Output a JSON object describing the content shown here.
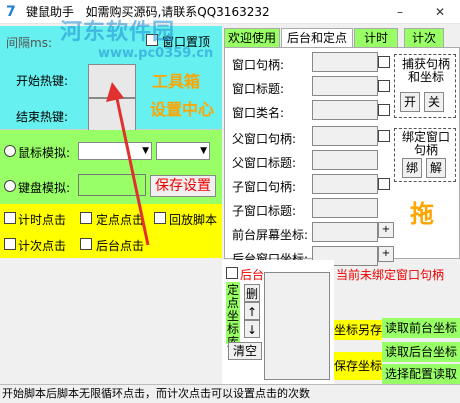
{
  "title": {
    "app_name": "键鼠助手",
    "promo": "如需购买源码,请联系QQ3163232",
    "minimize": "–",
    "close": "✕"
  },
  "watermark": {
    "name": "河东软件园",
    "url": "www.pc0359.cn"
  },
  "hotkeys": {
    "time_label": "间隔ms:",
    "window_top_label": "窗口置顶",
    "start_label": "开始热键:",
    "end_label": "结束热键:",
    "toolbox": "工具箱",
    "settings_center": "设置中心"
  },
  "mouse_sim": {
    "label": "鼠标模拟:"
  },
  "keyboard_sim": {
    "label": "键盘模拟:",
    "save_button": "保存设置"
  },
  "click_modes": {
    "timed": "计时点击",
    "fixed": "定点点击",
    "replay": "回放脚本",
    "counted": "计次点击",
    "background": "后台点击"
  },
  "tabs": [
    "欢迎使用",
    "后台和定点",
    "计时",
    "计次"
  ],
  "window_fields": {
    "handle": "窗口句柄:",
    "title": "窗口标题:",
    "class": "窗口类名:",
    "parent_handle": "父窗口句柄:",
    "parent_title": "父窗口标题:",
    "child_handle": "子窗口句柄:",
    "child_title": "子窗口标题:",
    "front_coord": "前台屏幕坐标:",
    "back_coord": "后台窗口坐标:"
  },
  "capture": {
    "title": "捕获句柄和坐标",
    "on": "开",
    "off": "关"
  },
  "bind": {
    "title": "绑定窗口句柄",
    "bind_btn": "绑",
    "unbind_btn": "解"
  },
  "drag_label": "拖",
  "background_chk": "后台",
  "status_unbound": "当前未绑定窗口句柄",
  "coord_library": {
    "vertical": [
      "定",
      "点",
      "坐",
      "标",
      "库"
    ],
    "delete": "删",
    "up": "↑",
    "down": "↓",
    "clear": "清空"
  },
  "actions": {
    "save_coord_as": "坐标另存",
    "save_coord": "保存坐标",
    "read_front_coord": "读取前台坐标",
    "read_back_coord": "读取后台坐标",
    "select_config": "选择配置读取"
  },
  "status_bar": "开始脚本后脚本无限循环点击，而计次点击可以设置点击的次数",
  "colors": {
    "cyan": "#66f0ef",
    "green": "#99ff66",
    "yellow": "#ffff00",
    "orange": "#ffa500",
    "red": "#e00000"
  }
}
